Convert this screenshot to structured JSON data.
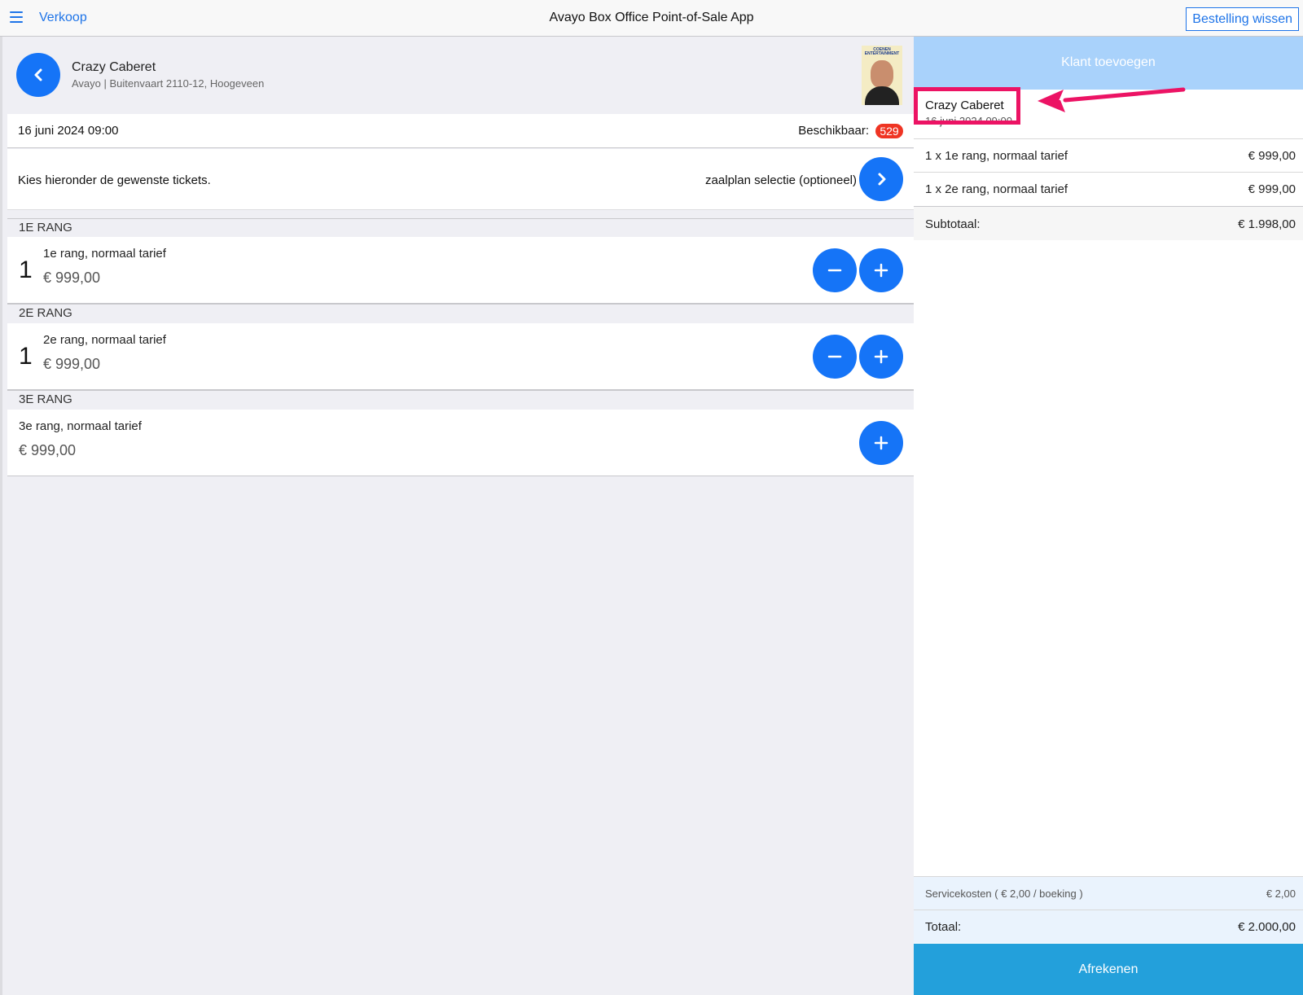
{
  "topbar": {
    "menu_icon": "hamburger-menu-icon",
    "nav_label": "Verkoop",
    "title": "Avayo Box Office Point-of-Sale App",
    "clear_label": "Bestelling wissen"
  },
  "event": {
    "title": "Crazy Caberet",
    "venue": "Avayo | Buitenvaart 2110-12, Hoogeveen",
    "poster_text": "COENEN ENTERTAINMENT",
    "date": "16 juni 2024 09:00",
    "available_label": "Beschikbaar:",
    "available_count": "529",
    "choose_text": "Kies hieronder de gewenste tickets.",
    "seatmap_label": "zaalplan selectie (optioneel)"
  },
  "ranks": [
    {
      "header": "1E RANG",
      "qty": "1",
      "name": "1e rang, normaal tarief",
      "price": "€ 999,00"
    },
    {
      "header": "2E RANG",
      "qty": "1",
      "name": "2e rang, normaal tarief",
      "price": "€ 999,00"
    },
    {
      "header": "3E RANG",
      "qty": "",
      "name": "3e rang, normaal tarief",
      "price": "€ 999,00"
    }
  ],
  "cart": {
    "add_customer_label": "Klant toevoegen",
    "event_title": "Crazy Caberet",
    "event_date": "16 juni 2024 09:00",
    "lines": [
      {
        "desc": "1 x 1e rang, normaal tarief",
        "price": "€ 999,00"
      },
      {
        "desc": "1 x 2e rang, normaal tarief",
        "price": "€ 999,00"
      }
    ],
    "subtotal_label": "Subtotaal:",
    "subtotal_value": "€ 1.998,00",
    "fees_label": "Servicekosten ( € 2,00 / boeking )",
    "fees_value": "€ 2,00",
    "total_label": "Totaal:",
    "total_value": "€ 2.000,00",
    "checkout_label": "Afrekenen"
  },
  "colors": {
    "primary": "#1574f7",
    "badge": "#ef3423",
    "highlight": "#ec1364",
    "checkout": "#23a0db",
    "add_customer": "#a9d2fb"
  }
}
